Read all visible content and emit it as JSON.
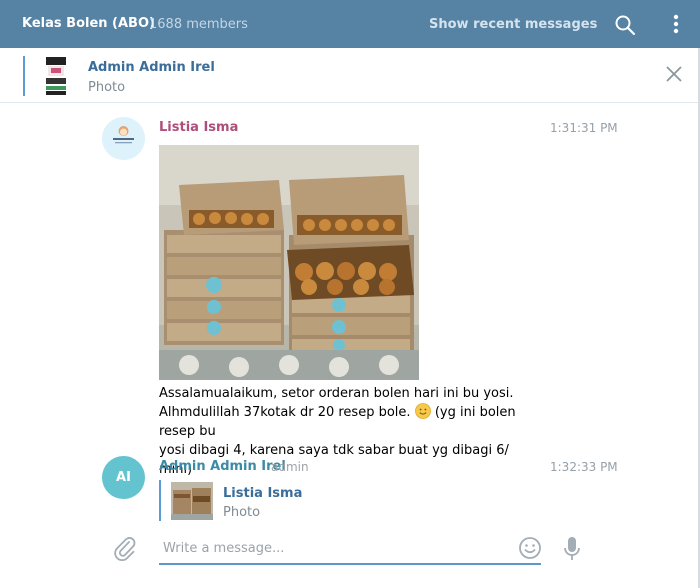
{
  "header": {
    "title": "Kelas Bolen (ABO)",
    "members": "1688 members",
    "recent_label": "Show recent messages",
    "icons": {
      "search": "search-icon",
      "more": "more-vertical-icon"
    }
  },
  "pinned": {
    "author": "Admin Admin Irel",
    "subtitle": "Photo",
    "close_icon": "close-icon"
  },
  "messages": [
    {
      "author": "Listia Isma",
      "time": "1:31:31 PM",
      "line1": "Assalamualaikum, setor orderan bolen hari ini bu yosi.",
      "line2a": "Alhmdulillah 37kotak dr 20 resep bole.",
      "line2b": "(yg ini bolen resep bu",
      "line3": "yosi dibagi 4, karena saya tdk sabar buat yg dibagi 6/ mini)"
    },
    {
      "author": "Admin Admin Irel",
      "role": "admin",
      "avatar_initials": "AI",
      "time": "1:32:33 PM",
      "reply": {
        "author": "Listia Isma",
        "subtitle": "Photo"
      }
    }
  ],
  "composer": {
    "placeholder": "Write a message...",
    "icons": {
      "attach": "paperclip-icon",
      "emoji": "smile-icon",
      "mic": "microphone-icon"
    }
  },
  "colors": {
    "header_bg": "#5682a3",
    "accent_blue": "#5b9bd5",
    "author_pink": "#ad4f79",
    "author_teal": "#3c8ba6",
    "avatar_teal": "#63c3ce"
  }
}
